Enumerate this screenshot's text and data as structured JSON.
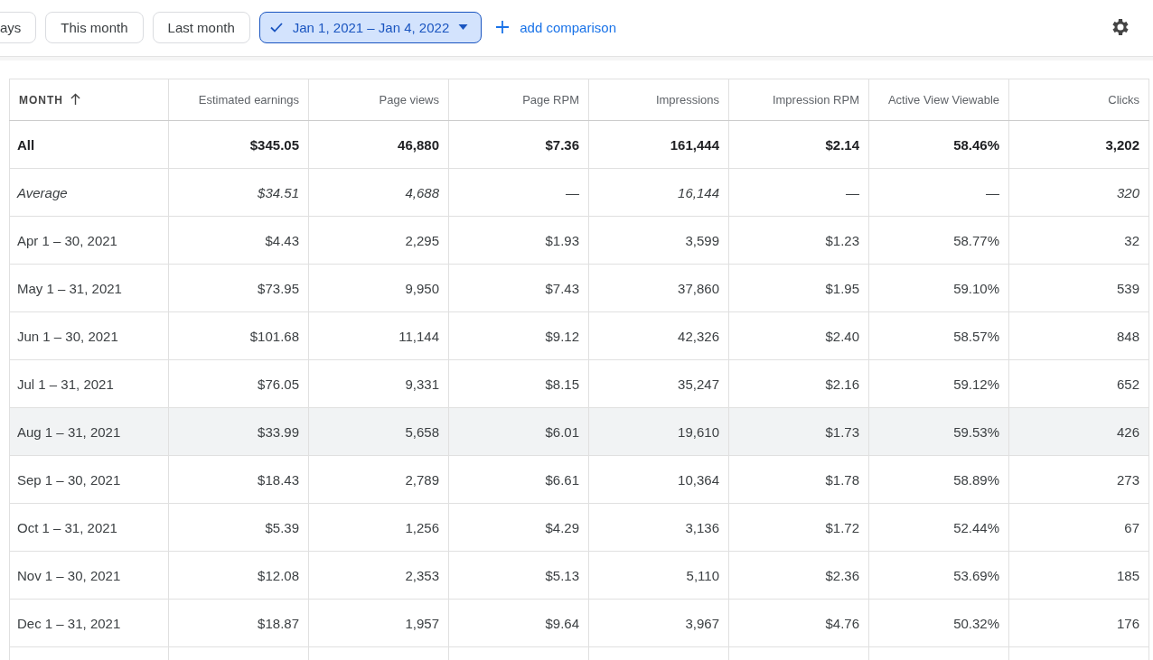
{
  "filters": [
    {
      "label": "ays",
      "selected": false,
      "dropdown": false
    },
    {
      "label": "This month",
      "selected": false,
      "dropdown": false
    },
    {
      "label": "Last month",
      "selected": false,
      "dropdown": false
    },
    {
      "label": "Jan 1, 2021 – Jan 4, 2022",
      "selected": true,
      "dropdown": true
    }
  ],
  "add_comparison": "add comparison",
  "table": {
    "columns": [
      {
        "label": "MONTH",
        "sorted": true
      },
      {
        "label": "Estimated earnings",
        "sorted": false
      },
      {
        "label": "Page views",
        "sorted": false
      },
      {
        "label": "Page RPM",
        "sorted": false
      },
      {
        "label": "Impressions",
        "sorted": false
      },
      {
        "label": "Impression RPM",
        "sorted": false
      },
      {
        "label": "Active View Viewable",
        "sorted": false
      },
      {
        "label": "Clicks",
        "sorted": false
      }
    ],
    "rows": [
      {
        "kind": "total",
        "highlighted": false,
        "cells": [
          "All",
          "$345.05",
          "46,880",
          "$7.36",
          "161,444",
          "$2.14",
          "58.46%",
          "3,202"
        ]
      },
      {
        "kind": "average",
        "highlighted": false,
        "cells": [
          "Average",
          "$34.51",
          "4,688",
          "—",
          "16,144",
          "—",
          "—",
          "320"
        ]
      },
      {
        "kind": "month",
        "highlighted": false,
        "cells": [
          "Apr 1 – 30, 2021",
          "$4.43",
          "2,295",
          "$1.93",
          "3,599",
          "$1.23",
          "58.77%",
          "32"
        ]
      },
      {
        "kind": "month",
        "highlighted": false,
        "cells": [
          "May 1 – 31, 2021",
          "$73.95",
          "9,950",
          "$7.43",
          "37,860",
          "$1.95",
          "59.10%",
          "539"
        ]
      },
      {
        "kind": "month",
        "highlighted": false,
        "cells": [
          "Jun 1 – 30, 2021",
          "$101.68",
          "11,144",
          "$9.12",
          "42,326",
          "$2.40",
          "58.57%",
          "848"
        ]
      },
      {
        "kind": "month",
        "highlighted": false,
        "cells": [
          "Jul 1 – 31, 2021",
          "$76.05",
          "9,331",
          "$8.15",
          "35,247",
          "$2.16",
          "59.12%",
          "652"
        ]
      },
      {
        "kind": "month",
        "highlighted": true,
        "cells": [
          "Aug 1 – 31, 2021",
          "$33.99",
          "5,658",
          "$6.01",
          "19,610",
          "$1.73",
          "59.53%",
          "426"
        ]
      },
      {
        "kind": "month",
        "highlighted": false,
        "cells": [
          "Sep 1 – 30, 2021",
          "$18.43",
          "2,789",
          "$6.61",
          "10,364",
          "$1.78",
          "58.89%",
          "273"
        ]
      },
      {
        "kind": "month",
        "highlighted": false,
        "cells": [
          "Oct 1 – 31, 2021",
          "$5.39",
          "1,256",
          "$4.29",
          "3,136",
          "$1.72",
          "52.44%",
          "67"
        ]
      },
      {
        "kind": "month",
        "highlighted": false,
        "cells": [
          "Nov 1 – 30, 2021",
          "$12.08",
          "2,353",
          "$5.13",
          "5,110",
          "$2.36",
          "53.69%",
          "185"
        ]
      },
      {
        "kind": "month",
        "highlighted": false,
        "cells": [
          "Dec 1 – 31, 2021",
          "$18.87",
          "1,957",
          "$9.64",
          "3,967",
          "$4.76",
          "50.32%",
          "176"
        ]
      }
    ]
  }
}
